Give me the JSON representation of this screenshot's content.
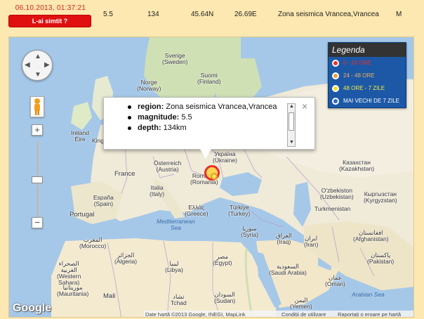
{
  "event": {
    "timestamp": "06.10.2013, 01:37:21",
    "felt_button": "L-ai simtit ?",
    "magnitude": "5.5",
    "depth": "134",
    "lat": "45.64N",
    "lon": "26.69E",
    "region": "Zona seismica Vrancea,Vrancea",
    "type": "M"
  },
  "map": {
    "labels": {
      "sverige": "Sverige\n(Sweden)",
      "suomi": "Suomi\n(Finland)",
      "norge": "Norge\n(Norway)",
      "ireland": "Ireland\nÉire",
      "united_kingdom": "Kingdom",
      "ukraina": "Україна\n(Ukraine)",
      "france": "France",
      "osterreich": "Österreich\n(Austria)",
      "romania": "România\n(Romania)",
      "kazakhstan": "Казахстан\n(Kazakhstan)",
      "espana": "España\n(Spain)",
      "italia": "Italia\n(Italy)",
      "portugal": "Portugal",
      "ellada": "Ελλάς\n(Greece)",
      "turkiye": "Türkiye\n(Turkey)",
      "uzbekistan": "O'zbekiston\n(Uzbekistan)",
      "kyrgyzstan": "Кыргызстан\n(Kyrgyzstan)",
      "turkmenistan": "Turkmenistan",
      "mediterranean": "Mediterranean\nSea",
      "maroc": "المغرب\n(Morocco)",
      "syria": "سوريا\n(Syria)",
      "iraq": "العراق\n(Iraq)",
      "iran": "ایران\n(Iran)",
      "afghanistan": "افغانستان\n(Afghanistan)",
      "pakistan": "پاکستان\n(Pakistan)",
      "algerie": "الجزائر\n(Algeria)",
      "libya": "ليبيا\n(Libya)",
      "egypt": "مصر\n(Egypt)",
      "saudi": "السعودية\n(Saudi Arabia)",
      "oman": "عمان\n(Oman)",
      "western_sahara": "الصحراء\nالغربية\n(Western\nSahara)",
      "mauritania": "موريتانيا\n(Mauritania)",
      "mali": "Mali",
      "tchad": "تشاد\nTchad",
      "sudan": "السودان\n(Sudan)",
      "yemen": "اليمن\n(Yemen)",
      "arabian_sea": "Arabian Sea"
    },
    "legend": {
      "title": "Legenda",
      "items": [
        {
          "label": "0 - 24 ORE",
          "color": "#e8302a"
        },
        {
          "label": "24 - 48 ORE",
          "color": "#e8a040"
        },
        {
          "label": "48 ORE - 7 ZILE",
          "color": "#f0e020"
        },
        {
          "label": "MAI VECHI DE 7 ZILE",
          "color": "#2a6ad0"
        }
      ]
    },
    "popup": {
      "region_key": "region:",
      "region_val": "Zona seismica Vrancea,Vrancea",
      "magnitude_key": "magnitude:",
      "magnitude_val": "5.5",
      "depth_key": "depth:",
      "depth_val": "134km"
    },
    "zoom_in": "+",
    "zoom_out": "−",
    "google_logo": "Google",
    "footer": {
      "data": "Date hartă ©2013 Google, INEGI, MapLink",
      "terms": "Condiții de utilizare",
      "report": "Raportați o eroare pe hartă"
    }
  },
  "colors": {
    "background": "#fce8b0",
    "water": "#a6c8e8",
    "land": "#f0ead8",
    "forest": "#cfe0b4",
    "desert": "#f4ead0",
    "felt_button": "#e01010",
    "timestamp": "#d02020",
    "legend_bg": "#1c58a6"
  }
}
